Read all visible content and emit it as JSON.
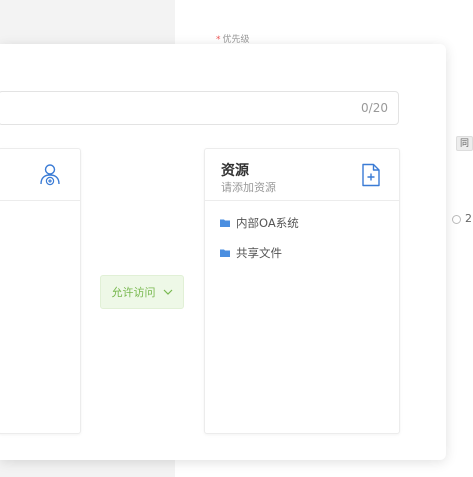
{
  "background": {
    "priority_label": "优先级",
    "required_mark": "*",
    "same_tag": "同",
    "truncated_value": "2"
  },
  "modal": {
    "name_input": {
      "count": "0/20"
    },
    "users_card": {
      "icon": "user-add-icon"
    },
    "resources_card": {
      "title": "资源",
      "subtitle": "请添加资源",
      "icon": "file-add-icon",
      "items": [
        {
          "label": "内部OA系统",
          "icon": "folder-icon"
        },
        {
          "label": "共享文件",
          "icon": "folder-icon"
        }
      ]
    },
    "access_select": {
      "label": "允许访问",
      "icon": "chevron-down-icon"
    }
  },
  "colors": {
    "accent_blue": "#3a7bd5",
    "folder_blue": "#4a8ee0",
    "access_green": "#78b84f",
    "access_bg": "#eef8e7"
  }
}
